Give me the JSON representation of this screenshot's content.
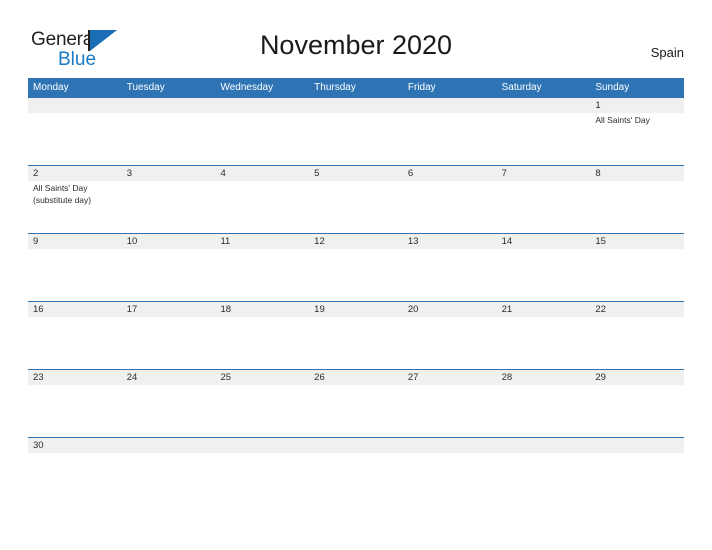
{
  "brand": {
    "name_part1": "General",
    "name_part2": "Blue",
    "accent_color": "#1a7ac4",
    "triangle_icon": "triangle-icon"
  },
  "header": {
    "title": "November 2020",
    "country": "Spain"
  },
  "calendar": {
    "weekday_headers": [
      "Monday",
      "Tuesday",
      "Wednesday",
      "Thursday",
      "Friday",
      "Saturday",
      "Sunday"
    ],
    "header_color": "#2e74b5",
    "date_band_color": "#f0f0f0",
    "weeks": [
      {
        "dates": [
          "",
          "",
          "",
          "",
          "",
          "",
          "1"
        ],
        "events": [
          "",
          "",
          "",
          "",
          "",
          "",
          "All Saints' Day"
        ]
      },
      {
        "dates": [
          "2",
          "3",
          "4",
          "5",
          "6",
          "7",
          "8"
        ],
        "events": [
          "All Saints' Day\n(substitute day)",
          "",
          "",
          "",
          "",
          "",
          ""
        ]
      },
      {
        "dates": [
          "9",
          "10",
          "11",
          "12",
          "13",
          "14",
          "15"
        ],
        "events": [
          "",
          "",
          "",
          "",
          "",
          "",
          ""
        ]
      },
      {
        "dates": [
          "16",
          "17",
          "18",
          "19",
          "20",
          "21",
          "22"
        ],
        "events": [
          "",
          "",
          "",
          "",
          "",
          "",
          ""
        ]
      },
      {
        "dates": [
          "23",
          "24",
          "25",
          "26",
          "27",
          "28",
          "29"
        ],
        "events": [
          "",
          "",
          "",
          "",
          "",
          "",
          ""
        ]
      },
      {
        "dates": [
          "30",
          "",
          "",
          "",
          "",
          "",
          ""
        ],
        "events": [
          "",
          "",
          "",
          "",
          "",
          "",
          ""
        ]
      }
    ]
  }
}
